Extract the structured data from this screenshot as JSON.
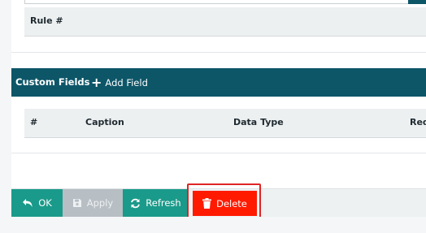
{
  "rule_table": {
    "header": "Rule #"
  },
  "custom_fields": {
    "title": "Custom Fields",
    "add_label": "Add Field",
    "columns": [
      "#",
      "Caption",
      "Data Type",
      "Req"
    ]
  },
  "footer": {
    "ok_label": "OK",
    "apply_label": "Apply",
    "refresh_label": "Refresh",
    "delete_label": "Delete"
  },
  "colors": {
    "header_bar": "#0d5668",
    "primary_button": "#1a9a8a",
    "disabled_button": "#b7bec4",
    "danger_button": "#ff1a00",
    "highlight_outline": "#e02424"
  },
  "icons": {
    "ok": "undo-arrow-icon",
    "apply": "save-floppy-icon",
    "refresh": "refresh-icon",
    "delete": "trash-icon",
    "add": "plus-icon"
  }
}
